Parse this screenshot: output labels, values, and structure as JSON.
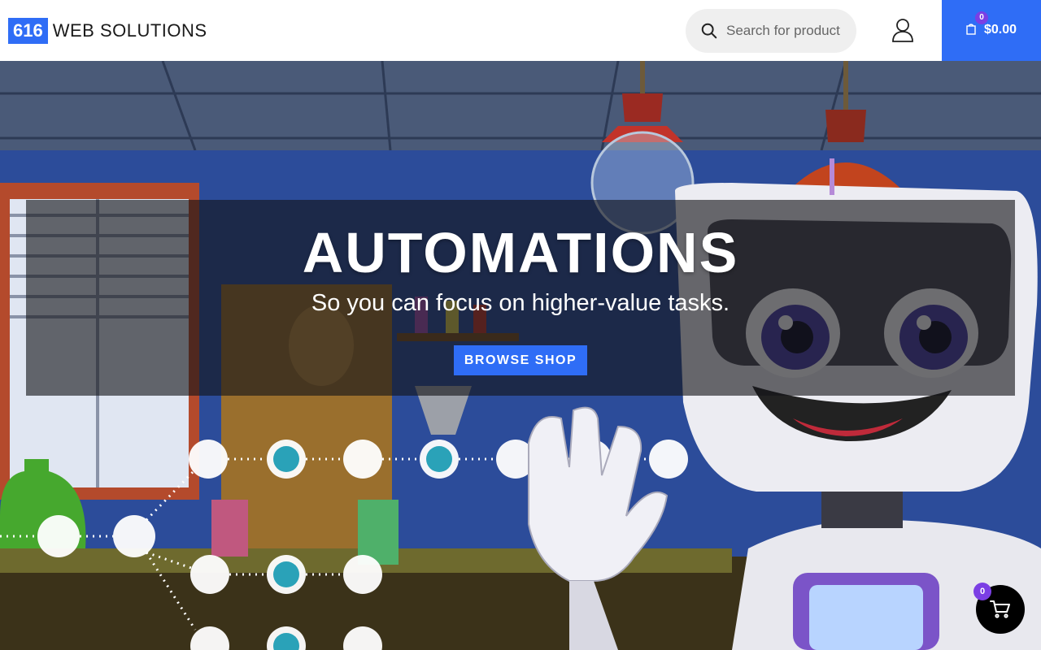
{
  "header": {
    "logo_badge": "616",
    "logo_text": "WEB SOLUTIONS",
    "search_placeholder": "Search for products",
    "cart_total": "$0.00",
    "cart_count": "0"
  },
  "hero": {
    "title": "AUTOMATIONS",
    "subtitle": "So you can focus on higher-value tasks.",
    "cta_label": "BROWSE SHOP"
  },
  "floating_cart": {
    "count": "0"
  },
  "colors": {
    "accent": "#2f6df6",
    "badge": "#7b3fe4"
  }
}
